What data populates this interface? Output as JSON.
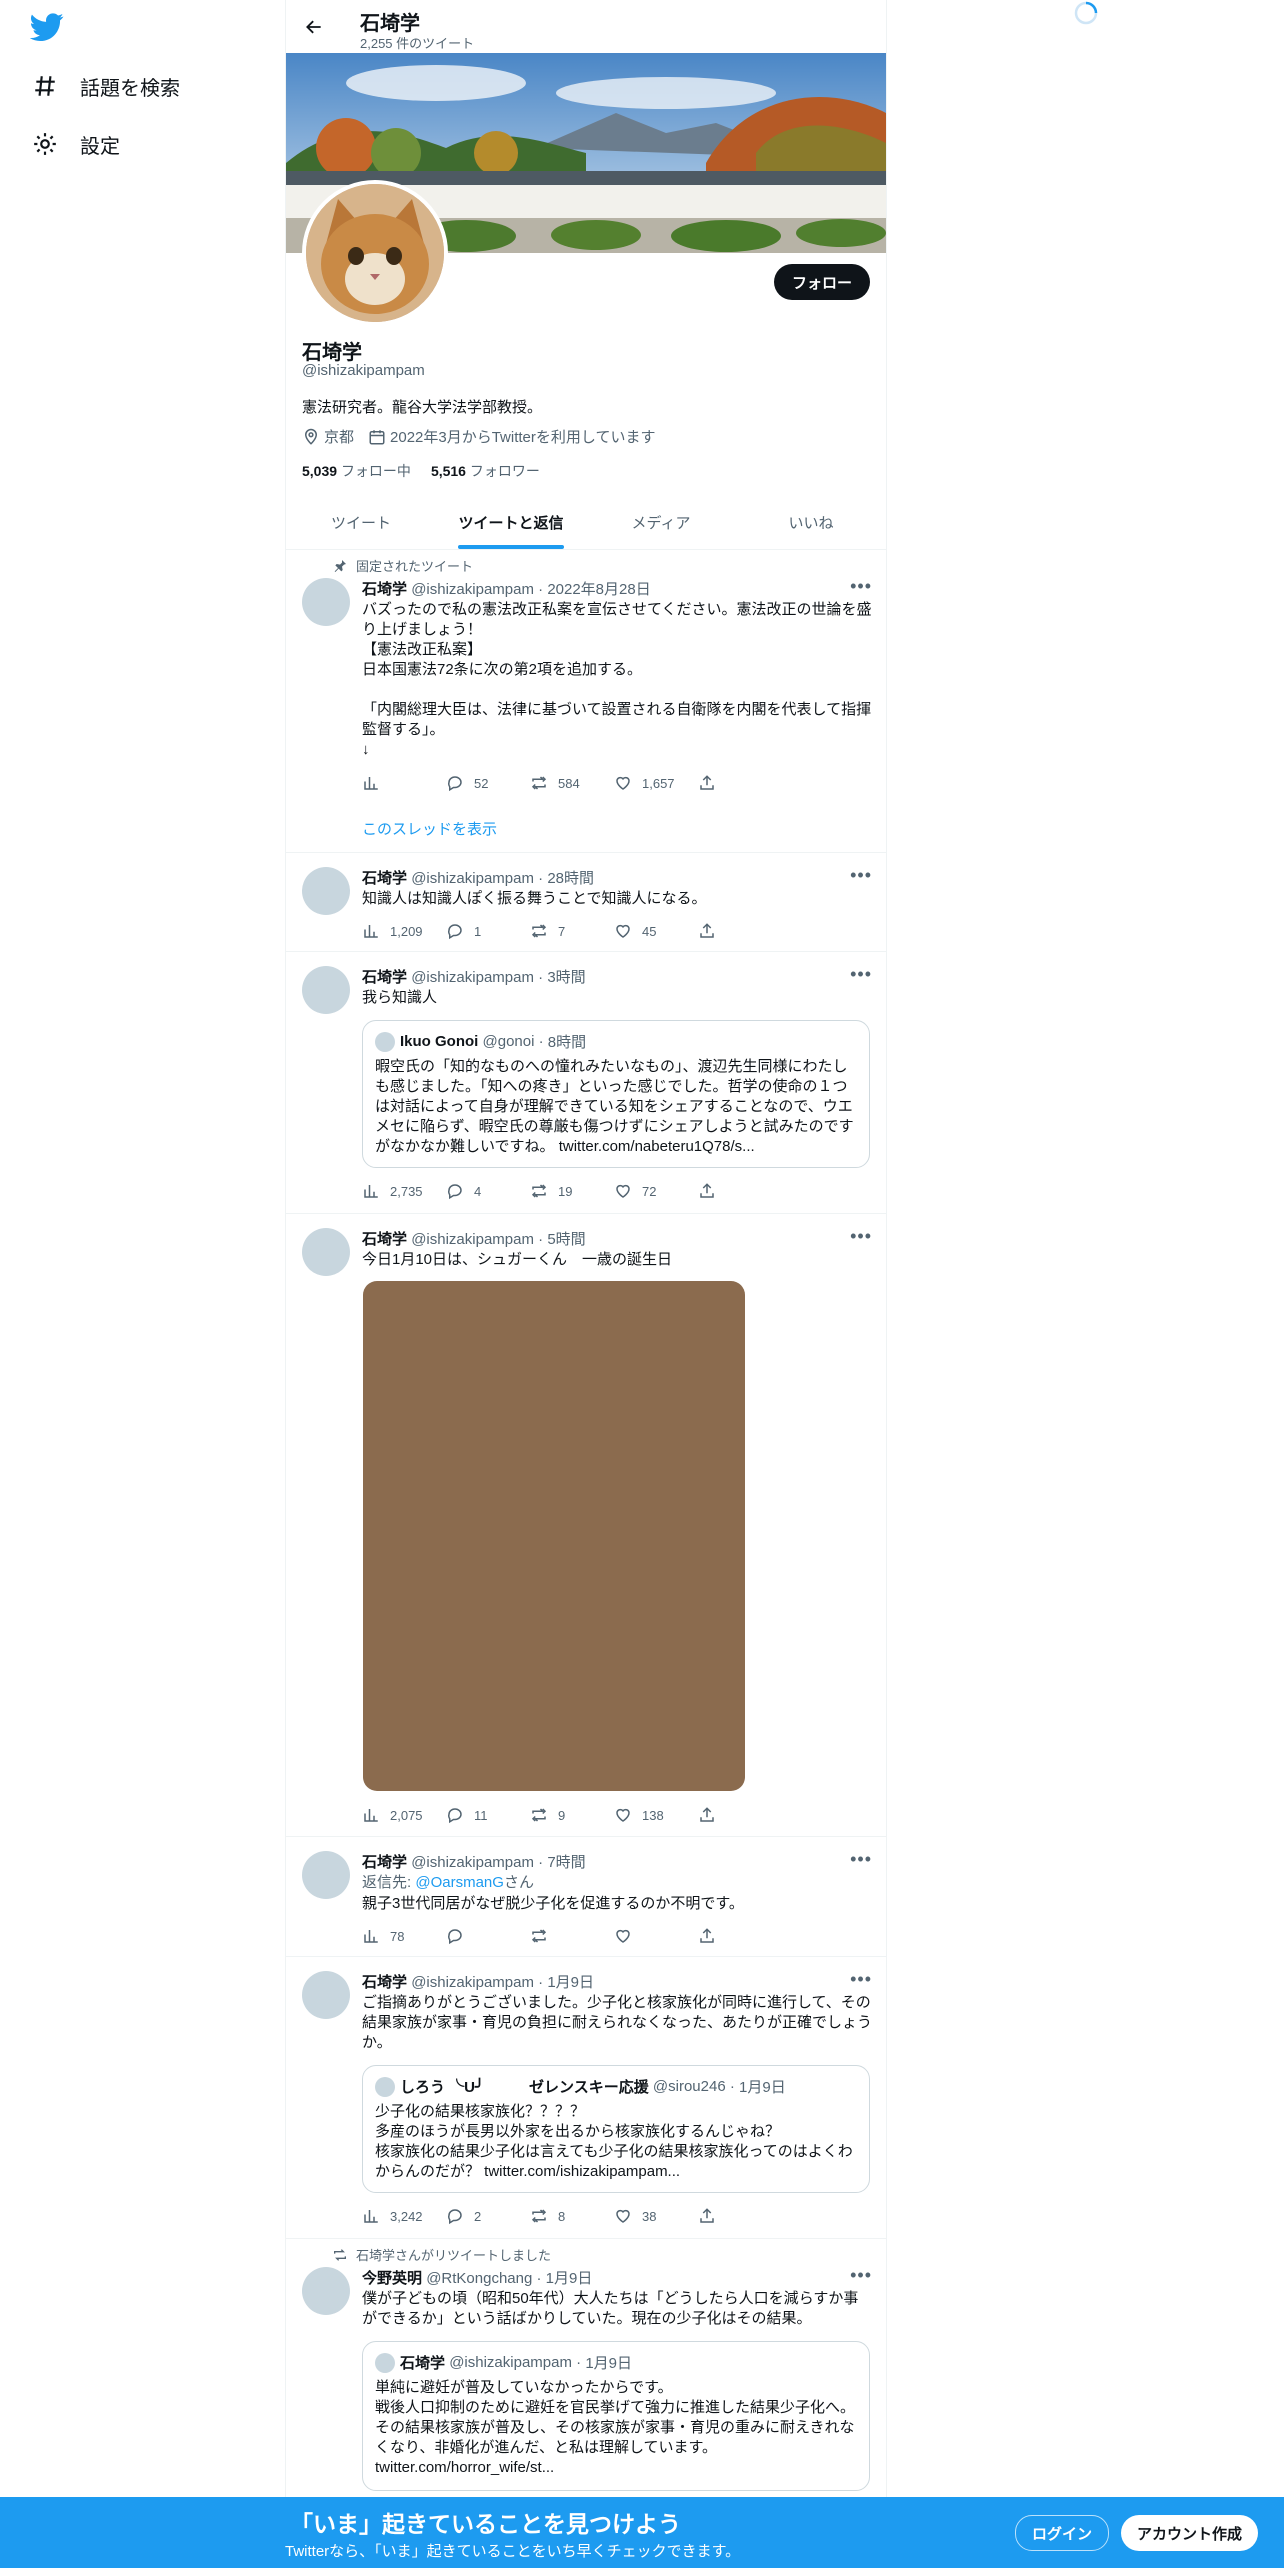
{
  "nav": {
    "explore_label": "話題を検索",
    "settings_label": "設定"
  },
  "header": {
    "title": "石埼学",
    "tweet_count": "2,255 件のツイート"
  },
  "profile": {
    "name": "石埼学",
    "handle": "@ishizakipampam",
    "bio": "憲法研究者。龍谷大学法学部教授。",
    "location": "京都",
    "joined": "2022年3月からTwitterを利用しています",
    "following_count": "5,039",
    "following_label": "フォロー中",
    "followers_count": "5,516",
    "followers_label": "フォロワー",
    "follow_button": "フォロー"
  },
  "tabs": [
    "ツイート",
    "ツイートと返信",
    "メディア",
    "いいね"
  ],
  "tweets": [
    {
      "context": "固定されたツイート",
      "name": "石埼学",
      "handle": "@ishizakipampam",
      "time": "2022年8月28日",
      "text": "バズったので私の憲法改正私案を宣伝させてください。憲法改正の世論を盛り上げましょう！\n【憲法改正私案】\n日本国憲法72条に次の第2項を追加する。\n\n「内閣総理大臣は、法律に基づいて設置される自衛隊を内閣を代表して指揮監督する」。\n↓",
      "views": "",
      "replies": "52",
      "retweets": "584",
      "likes": "1,657",
      "thread_link": "このスレッドを表示"
    },
    {
      "name": "石埼学",
      "handle": "@ishizakipampam",
      "time": "28時間",
      "text": "知識人は知識人ぽく振る舞うことで知識人になる。",
      "views": "1,209",
      "replies": "1",
      "retweets": "7",
      "likes": "45"
    },
    {
      "name": "石埼学",
      "handle": "@ishizakipampam",
      "time": "3時間",
      "text": "我ら知識人",
      "quote": {
        "name": "Ikuo Gonoi",
        "handle": "@gonoi",
        "time": "8時間",
        "text": "暇空氏の「知的なものへの憧れみたいなもの」、渡辺先生同様にわたしも感じました。「知への疼き」といった感じでした。哲学の使命の１つは対話によって自身が理解できている知をシェアすることなので、ウエメセに陥らず、暇空氏の尊厳も傷つけずにシェアしようと試みたのですがなかなか難しいですね。 twitter.com/nabeteru1Q78/s..."
      },
      "views": "2,735",
      "replies": "4",
      "retweets": "19",
      "likes": "72"
    },
    {
      "name": "石埼学",
      "handle": "@ishizakipampam",
      "time": "5時間",
      "text": "今日1月10日は、シュガーくん　一歳の誕生日",
      "views": "2,075",
      "replies": "11",
      "retweets": "9",
      "likes": "138"
    },
    {
      "name": "石埼学",
      "handle": "@ishizakipampam",
      "time": "7時間",
      "reply_prefix": "返信先: ",
      "reply_to": "@OarsmanG",
      "reply_suffix": "さん",
      "text": "親子3世代同居がなぜ脱少子化を促進するのか不明です。",
      "views": "78",
      "replies": "",
      "retweets": "",
      "likes": ""
    },
    {
      "name": "石埼学",
      "handle": "@ishizakipampam",
      "time": "1月9日",
      "text": "ご指摘ありがとうございました。少子化と核家族化が同時に進行して、その結果家族が家事・育児の負担に耐えられなくなった、あたりが正確でしょうか。",
      "quote": {
        "name": "しろう ╰U╯　　　ゼレンスキー応援",
        "handle": "@sirou246",
        "time": "1月9日",
        "text": "少子化の結果核家族化？？？？\n多産のほうが長男以外家を出るから核家族化するんじゃね？\n核家族化の結果少子化は言えても少子化の結果核家族化ってのはよくわからんのだが？ twitter.com/ishizakipampam..."
      },
      "views": "3,242",
      "replies": "2",
      "retweets": "8",
      "likes": "38"
    },
    {
      "context": "石埼学さんがリツイートしました",
      "name": "今野英明",
      "handle": "@RtKongchang",
      "time": "1月9日",
      "text": "僕が子どもの頃（昭和50年代）大人たちは「どうしたら人口を減らすか事ができるか」という話ばかりしていた。現在の少子化はその結果。",
      "quote": {
        "name": "石埼学",
        "handle": "@ishizakipampam",
        "time": "1月9日",
        "text": "単純に避妊が普及していなかったからです。\n戦後人口抑制のために避妊を官民挙げて強力に推進した結果少子化へ。\nその結果核家族が普及し、その核家族が家事・育児の重みに耐えきれなくなり、非婚化が進んだ、と私は理解しています。\ntwitter.com/horror_wife/st..."
      }
    }
  ],
  "bottom": {
    "title": "「いま」起きていることを見つけよう",
    "subtitle": "Twitterなら、「いま」起きていることをいち早くチェックできます。",
    "login": "ログイン",
    "signup": "アカウント作成"
  }
}
